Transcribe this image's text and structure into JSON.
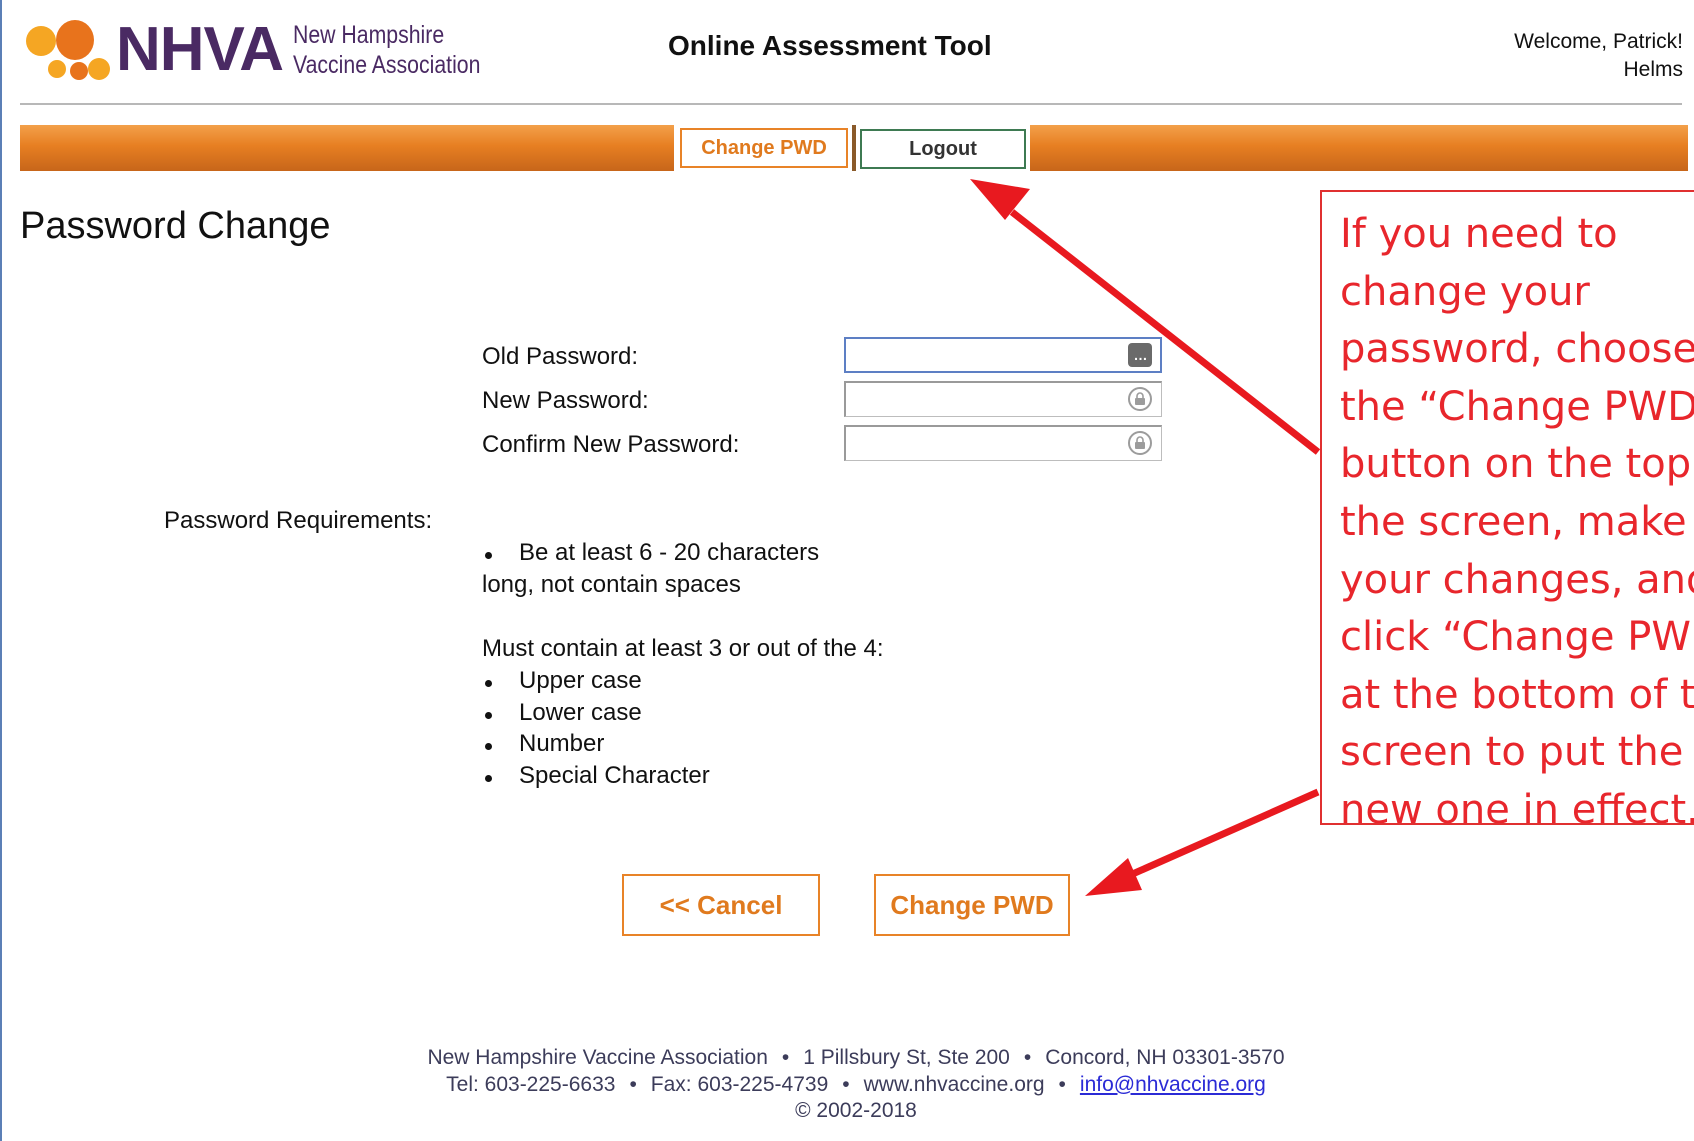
{
  "header": {
    "logo_text": "NHVA",
    "logo_sub_line1": "New Hampshire",
    "logo_sub_line2": "Vaccine Association",
    "app_title": "Online Assessment Tool",
    "welcome_line1": "Welcome, Patrick!",
    "welcome_line2": "Helms"
  },
  "nav": {
    "change_pwd_label": "Change PWD",
    "logout_label": "Logout"
  },
  "page": {
    "title": "Password Change"
  },
  "form": {
    "old_password_label": "Old Password:",
    "new_password_label": "New Password:",
    "confirm_password_label": "Confirm New Password:",
    "old_password_value": "",
    "new_password_value": "",
    "confirm_password_value": "",
    "old_password_icon": "…"
  },
  "requirements": {
    "heading": "Password Requirements:",
    "length_line1": "Be at least 6 - 20 characters",
    "length_line2": "long, not contain spaces",
    "must_contain": "Must contain at least 3 or out of the 4:",
    "items": [
      "Upper case",
      "Lower case",
      "Number",
      "Special Character"
    ]
  },
  "actions": {
    "cancel_label": "<<  Cancel",
    "change_label": "Change PWD"
  },
  "annotation": {
    "text": "If you need to\nchange your\npassword, choose\nthe “Change PWD”\nbutton on the top of\nthe screen, make\nyour changes, and\nclick “Change PWD”\nat the bottom of the\nscreen to put the\nnew one in effect.",
    "color": "#e8262c"
  },
  "footer": {
    "org": "New Hampshire Vaccine Association",
    "address": "1 Pillsbury St, Ste 200",
    "city": "Concord, NH 03301-3570",
    "tel": "Tel: 603-225-6633",
    "fax": "Fax: 603-225-4739",
    "website": "www.nhvaccine.org",
    "email": "info@nhvaccine.org",
    "copyright": "© 2002-2018"
  },
  "colors": {
    "brand_purple": "#4a2a63",
    "nav_orange": "#e77f22",
    "button_orange": "#e07a1e",
    "annotation_red": "#e8262c"
  }
}
